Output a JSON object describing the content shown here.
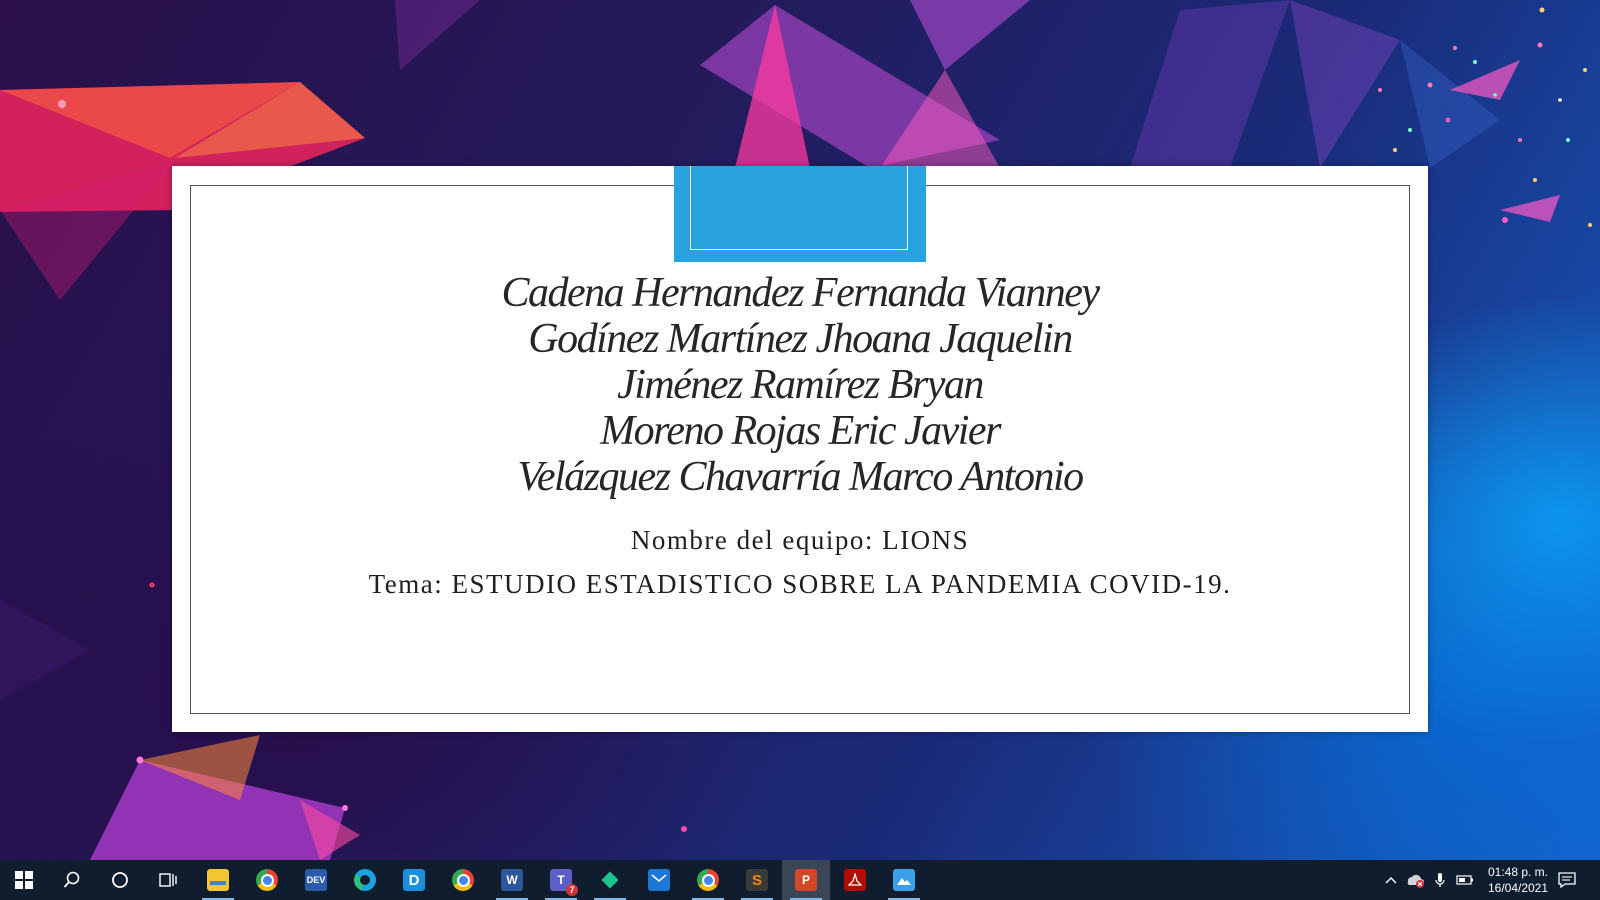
{
  "slide": {
    "names": [
      "Cadena Hernandez Fernanda Vianney",
      "Godínez Martínez Jhoana Jaquelin",
      "Jiménez Ramírez Bryan",
      "Moreno Rojas Eric Javier",
      "Velázquez Chavarría Marco Antonio"
    ],
    "team": "Nombre del equipo: LIONS",
    "topic": "Tema: ESTUDIO ESTADISTICO SOBRE LA PANDEMIA COVID-19.",
    "accent_color": "#29a3e0"
  },
  "taskbar": {
    "apps": [
      {
        "name": "file-explorer-icon",
        "color": "#f4c531"
      },
      {
        "name": "chrome-icon",
        "color": "#4285f4"
      },
      {
        "name": "devc-icon",
        "color": "#2a5cab",
        "label": "DEV"
      },
      {
        "name": "edge-icon",
        "color": "#1da1e0"
      },
      {
        "name": "dia-icon",
        "color": "#1b8fd8",
        "label": "D"
      },
      {
        "name": "chrome-profile-icon",
        "color": "#4285f4"
      },
      {
        "name": "word-icon",
        "color": "#2b579a",
        "label": "W"
      },
      {
        "name": "teams-icon",
        "color": "#5b5fc7",
        "label": "T",
        "badge": "7"
      },
      {
        "name": "kite-icon",
        "color": "#1ac88e"
      },
      {
        "name": "mail-icon",
        "color": "#1f77d4"
      },
      {
        "name": "chrome-second-icon",
        "color": "#4285f4"
      },
      {
        "name": "sublime-icon",
        "color": "#f08a00",
        "label": "S"
      },
      {
        "name": "powerpoint-icon",
        "color": "#d24726",
        "label": "P"
      },
      {
        "name": "acrobat-icon",
        "color": "#e2231a"
      },
      {
        "name": "photos-icon",
        "color": "#3aa0e8"
      }
    ],
    "time": "01:48 p. m.",
    "date": "16/04/2021"
  }
}
